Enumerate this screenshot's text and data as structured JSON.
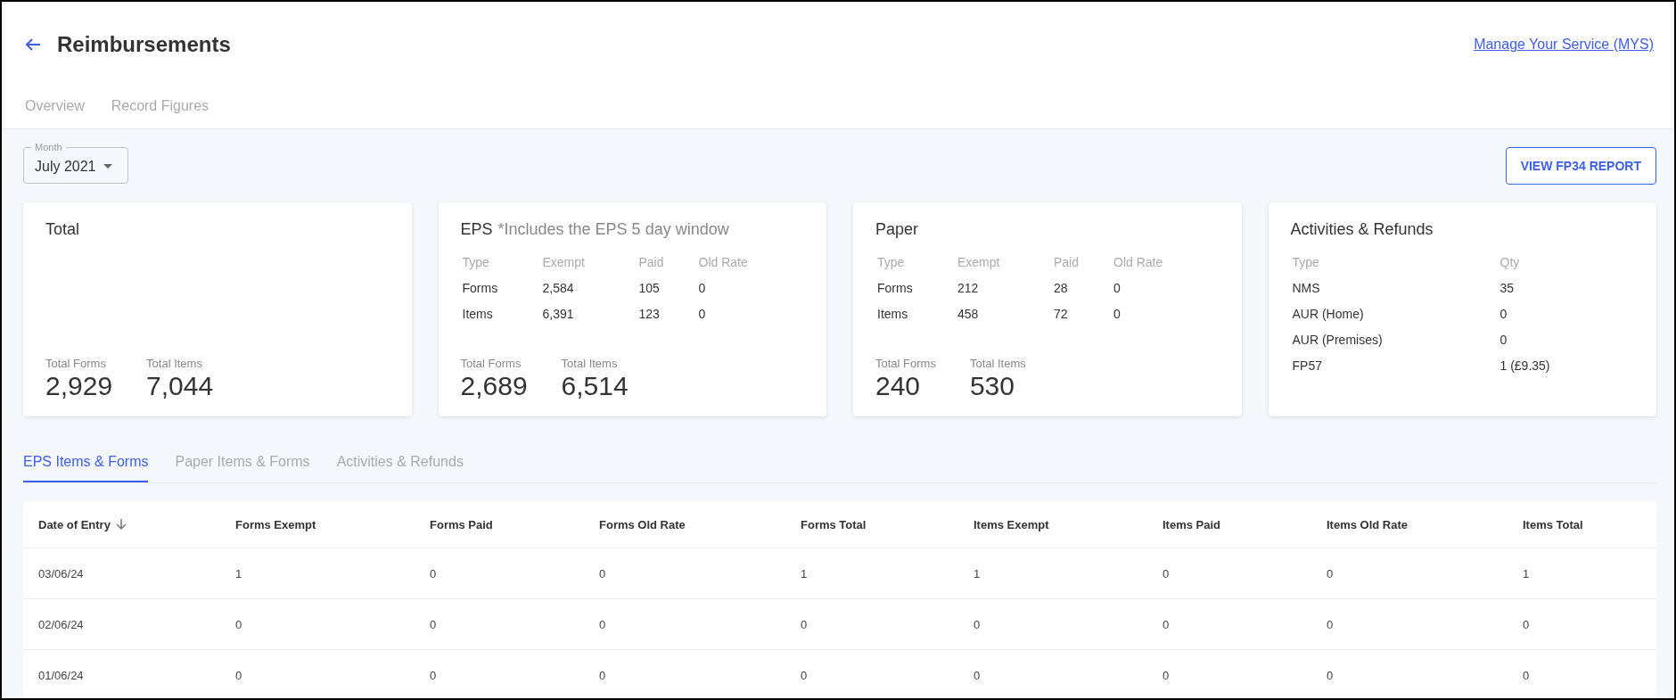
{
  "header": {
    "title": "Reimbursements",
    "link": "Manage Your Service (MYS)"
  },
  "tabs": [
    {
      "label": "Overview",
      "selected": false
    },
    {
      "label": "Record Figures",
      "selected": false
    }
  ],
  "month": {
    "label": "Month",
    "value": "July 2021"
  },
  "report_button": "VIEW FP34 REPORT",
  "cards": [
    {
      "title": "Total",
      "totals": [
        {
          "label": "Total Forms",
          "value": "2,929"
        },
        {
          "label": "Total Items",
          "value": "7,044"
        }
      ]
    },
    {
      "title": "EPS",
      "note": "*Includes the EPS 5 day window",
      "table": {
        "columns": [
          "Type",
          "Exempt",
          "Paid",
          "Old Rate"
        ],
        "rows": [
          [
            "Forms",
            "2,584",
            "105",
            "0"
          ],
          [
            "Items",
            "6,391",
            "123",
            "0"
          ]
        ]
      },
      "totals": [
        {
          "label": "Total Forms",
          "value": "2,689"
        },
        {
          "label": "Total Items",
          "value": "6,514"
        }
      ]
    },
    {
      "title": "Paper",
      "table": {
        "columns": [
          "Type",
          "Exempt",
          "Paid",
          "Old Rate"
        ],
        "rows": [
          [
            "Forms",
            "212",
            "28",
            "0"
          ],
          [
            "Items",
            "458",
            "72",
            "0"
          ]
        ]
      },
      "totals": [
        {
          "label": "Total Forms",
          "value": "240"
        },
        {
          "label": "Total Items",
          "value": "530"
        }
      ]
    },
    {
      "title": "Activities & Refunds",
      "table": {
        "columns": [
          "Type",
          "Qty"
        ],
        "rows": [
          [
            "NMS",
            "35"
          ],
          [
            "AUR (Home)",
            "0"
          ],
          [
            "AUR (Premises)",
            "0"
          ],
          [
            "FP57",
            "1 (£9.35)"
          ]
        ]
      }
    }
  ],
  "detail_tabs": [
    {
      "label": "EPS Items & Forms",
      "selected": true
    },
    {
      "label": "Paper Items & Forms",
      "selected": false
    },
    {
      "label": "Activities & Refunds",
      "selected": false
    }
  ],
  "table": {
    "columns": [
      "Date of Entry",
      "Forms Exempt",
      "Forms Paid",
      "Forms Old Rate",
      "Forms Total",
      "Items Exempt",
      "Items Paid",
      "Items Old Rate",
      "Items Total"
    ],
    "rows": [
      [
        "03/06/24",
        "1",
        "0",
        "0",
        "1",
        "1",
        "0",
        "0",
        "1"
      ],
      [
        "02/06/24",
        "0",
        "0",
        "0",
        "0",
        "0",
        "0",
        "0",
        "0"
      ],
      [
        "01/06/24",
        "0",
        "0",
        "0",
        "0",
        "0",
        "0",
        "0",
        "0"
      ]
    ]
  }
}
